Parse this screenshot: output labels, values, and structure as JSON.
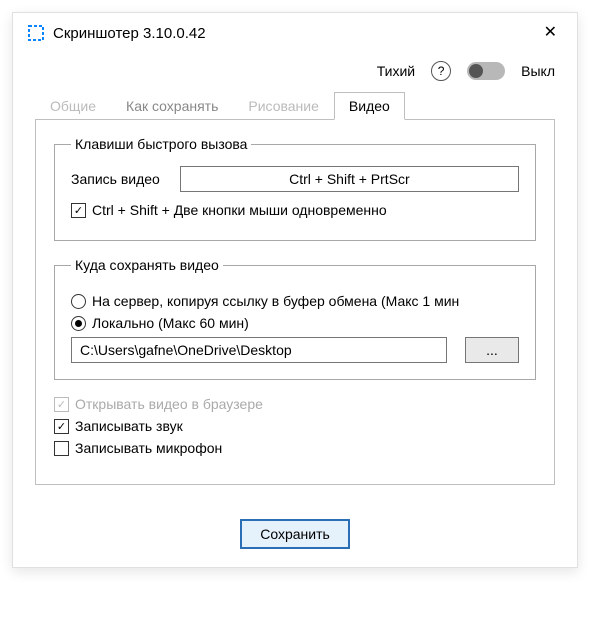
{
  "titlebar": {
    "title": "Скриншотер 3.10.0.42"
  },
  "toprow": {
    "quiet_label": "Тихий",
    "toggle_state_label": "Выкл"
  },
  "tabs": {
    "general": "Общие",
    "how_save": "Как сохранять",
    "drawing": "Рисование",
    "video": "Видео"
  },
  "hotkeys": {
    "legend": "Клавиши быстрого вызова",
    "record_label": "Запись видео",
    "record_hotkey": "Ctrl + Shift + PrtScr",
    "mouse_combo_label": "Ctrl + Shift + Две кнопки мыши одновременно"
  },
  "save_where": {
    "legend": "Куда сохранять видео",
    "server_label": "На сервер, копируя ссылку в буфер обмена (Макс 1 мин",
    "local_label": "Локально (Макс 60 мин)",
    "path": "C:\\Users\\gafne\\OneDrive\\Desktop",
    "browse_label": "..."
  },
  "options": {
    "open_browser": "Открывать видео в браузере",
    "record_sound": "Записывать звук",
    "record_mic": "Записывать микрофон"
  },
  "footer": {
    "save": "Сохранить"
  }
}
